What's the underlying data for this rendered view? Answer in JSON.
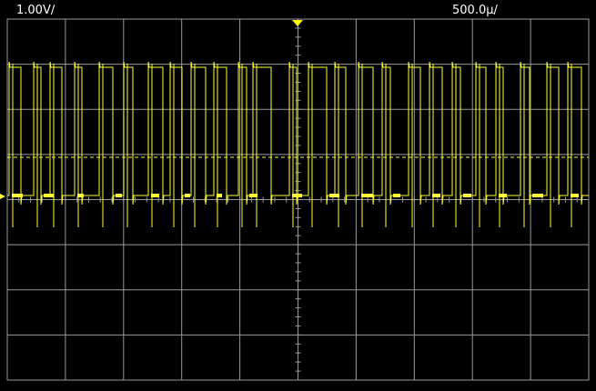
{
  "header": {
    "channel_scale": "1.00V/",
    "time_scale": "500.0µ/"
  },
  "colors": {
    "background": "#000000",
    "graticule": "#9a9a9a",
    "trace": "#ffff33",
    "trigger_marker": "#ffff00",
    "text": "#ffffff"
  },
  "graticule": {
    "horizontal_divisions": 10,
    "vertical_divisions": 8
  },
  "icons": {
    "trigger_marker": "trigger-position-triangle-icon"
  }
}
